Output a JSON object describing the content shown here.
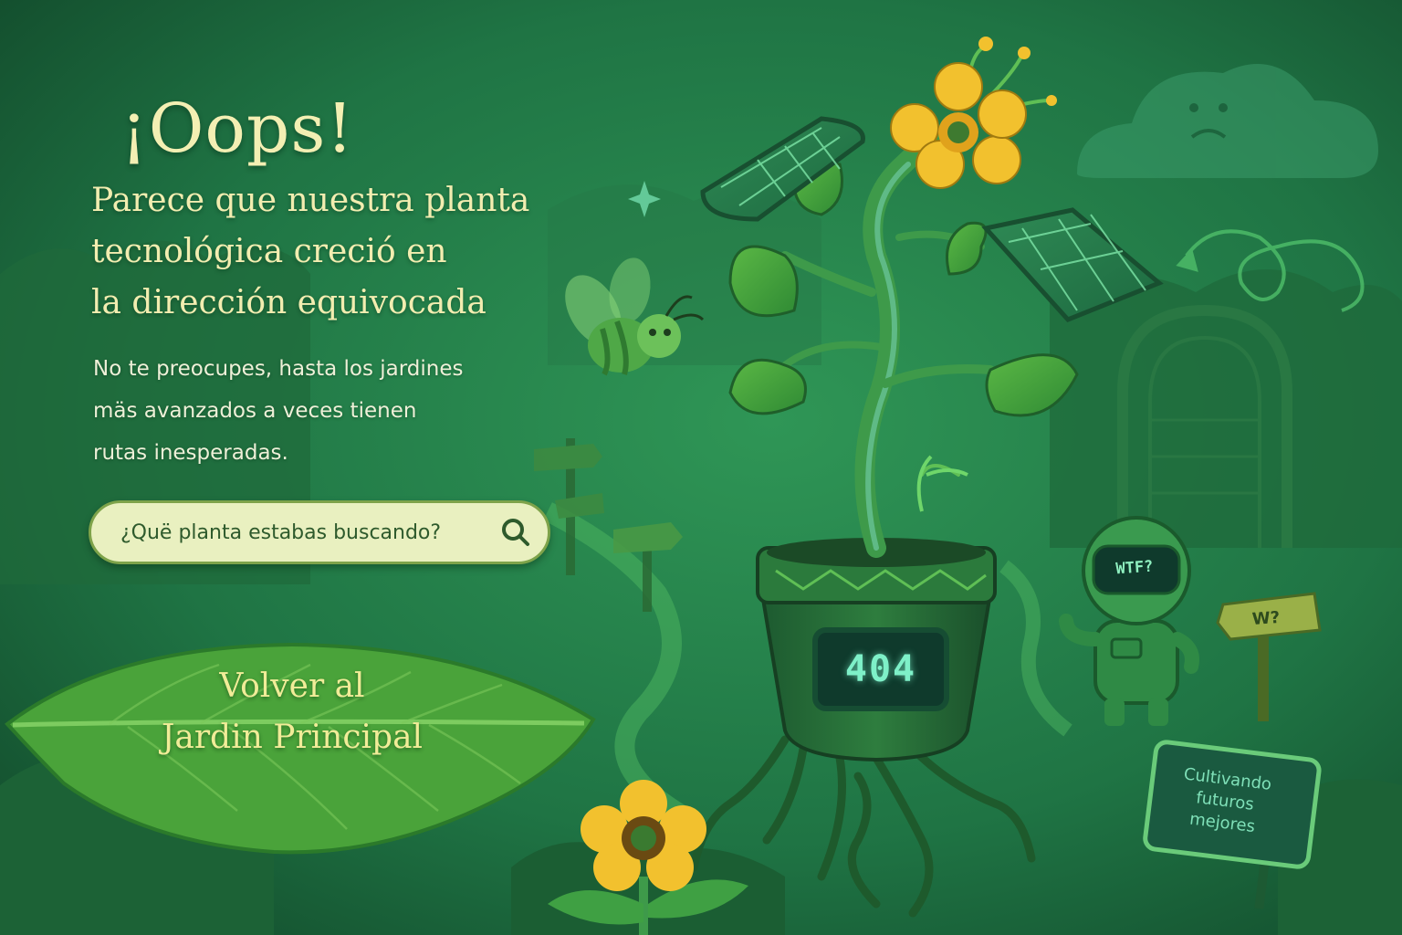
{
  "page": {
    "title": "¡Oops!",
    "subtitle_lines": [
      "Parece que nuestra planta",
      "tecnológica creció en",
      "la dirección equivocada"
    ],
    "body_lines": [
      "No te preocupes, hasta los jardines",
      "mäs avanzados a veces tienen",
      "rutas inesperadas."
    ]
  },
  "search": {
    "placeholder": "¿Quë planta estabas buscando?",
    "icon": "search-icon"
  },
  "home_button": {
    "label_lines": [
      "Volver al",
      "Jardin Principal"
    ]
  },
  "illustration": {
    "pot_display": "404",
    "robot_screen": "WTF?",
    "sign": "W?",
    "plaque_lines": [
      "Cultivando",
      "futuros",
      "mejores"
    ]
  },
  "colors": {
    "background": "#1d6a3f",
    "title_text": "#f3efb3",
    "search_bg": "#e9f0c0",
    "leaf": "#4aa33a",
    "flower": "#f2c12e",
    "digital_glow": "#7ef0c8"
  }
}
